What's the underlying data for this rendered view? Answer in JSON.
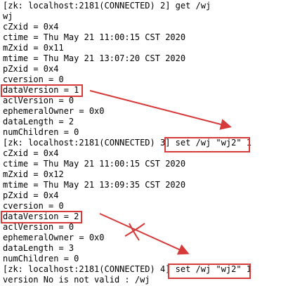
{
  "terminal": {
    "lines": [
      "[zk: localhost:2181(CONNECTED) 2] get /wj",
      "wj",
      "cZxid = 0x4",
      "ctime = Thu May 21 11:00:15 CST 2020",
      "mZxid = 0x11",
      "mtime = Thu May 21 13:07:20 CST 2020",
      "pZxid = 0x4",
      "cversion = 0",
      "dataVersion = 1",
      "aclVersion = 0",
      "ephemeralOwner = 0x0",
      "dataLength = 2",
      "numChildren = 0",
      "[zk: localhost:2181(CONNECTED) 3] set /wj \"wj2\" 1",
      "cZxid = 0x4",
      "ctime = Thu May 21 11:00:15 CST 2020",
      "mZxid = 0x12",
      "mtime = Thu May 21 13:09:35 CST 2020",
      "pZxid = 0x4",
      "cversion = 0",
      "dataVersion = 2",
      "aclVersion = 0",
      "ephemeralOwner = 0x0",
      "dataLength = 3",
      "numChildren = 0",
      "[zk: localhost:2181(CONNECTED) 4] set /wj \"wj2\" 1",
      "version No is not valid : /wj"
    ]
  },
  "annotations": {
    "color": "#d63a3a"
  }
}
